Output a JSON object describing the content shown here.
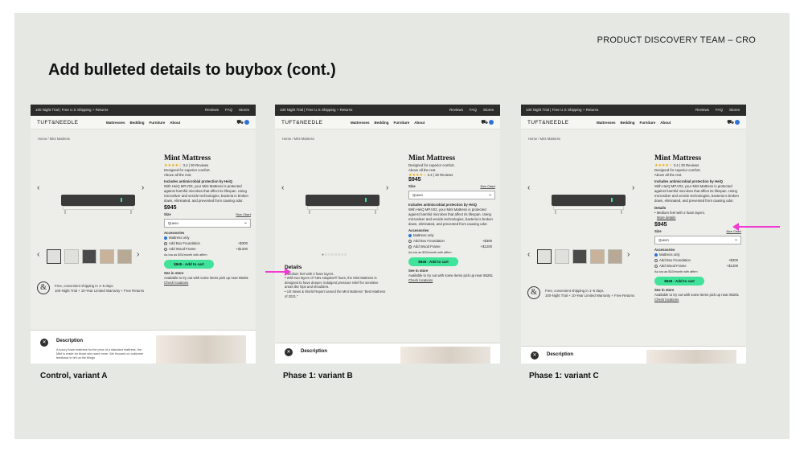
{
  "header": {
    "team": "PRODUCT DISCOVERY TEAM – CRO",
    "title": "Add bulleted details to buybox (cont.)"
  },
  "captions": [
    "Control, variant A",
    "Phase 1: variant B",
    "Phase 1: variant C"
  ],
  "site": {
    "topbar": "100 Night Trial | Free U.S Shipping + Returns",
    "toplinks": [
      "Reviews",
      "FAQ",
      "Stores"
    ],
    "logo": "TUFT&NEEDLE",
    "menu": [
      "Mattresses",
      "Bedding",
      "Furniture",
      "About"
    ],
    "cart_icon": "cart-icon",
    "breadcrumb": "Home / Mint Mattress",
    "product": {
      "name": "Mint Mattress",
      "stars": "★★★★☆",
      "rating": "3.4 | 30 Reviews",
      "tagline1": "Designed for superior comfort.",
      "tagline2": "Above all the rest.",
      "antimicrobial_title": "Includes antimicrobial protection by HeiQ",
      "antimicrobial_body": "With HeiQ MP,V03, your Mint Mattress is protected against harmful microbes that affect its lifespan. Using microsilver and vesicle technologies, bacteria is broken down, eliminated, and prevented from causing odor.",
      "price": "$945",
      "size_label": "Size",
      "size_chart": "Size Chart",
      "size_value": "Queen",
      "accessories_label": "Accessories",
      "options": [
        {
          "label": "Mattress only",
          "price": ""
        },
        {
          "label": "Add Box Foundation",
          "price": "+$300"
        },
        {
          "label": "Add Wood Frame",
          "price": "+$1200"
        }
      ],
      "financing": "As low as $33/month with affirm",
      "cta": "$945 - Add to cart",
      "see_store_title": "See in store",
      "see_store_body": "Available to try out with some items pick up near 85281",
      "check_locations": "Check locations"
    },
    "shipping_line1": "Free, convenient shipping in 1–5 days.",
    "shipping_line2": "100-Night Trial + 10-Year Limited Warranty + Free Returns",
    "description_title": "Description",
    "description_body": "A luxury foam mattress for the price of a standard mattress, the Mint is made for those who want more. We focused on customer feedback to tell us the things"
  },
  "details_b": {
    "title": "Details",
    "bullets": [
      "Medium feel with 2 foam layers.",
      "With two layers of T&N Adaptive® foam, the Mint Mattress is designed to have deeper, indulgent pressure relief for sensitive areas like hips and shoulders.",
      "US News & World Report named the Mint Mattress \"Best Mattress of 2021.\""
    ]
  },
  "details_c": {
    "title": "Details",
    "bullet": "Medium feel with 2 foam layers.",
    "more": "More details"
  },
  "colors": {
    "accent_green": "#3fe39a",
    "arrow_pink": "#f03bd2",
    "slide_bg": "#e6e8e4"
  }
}
